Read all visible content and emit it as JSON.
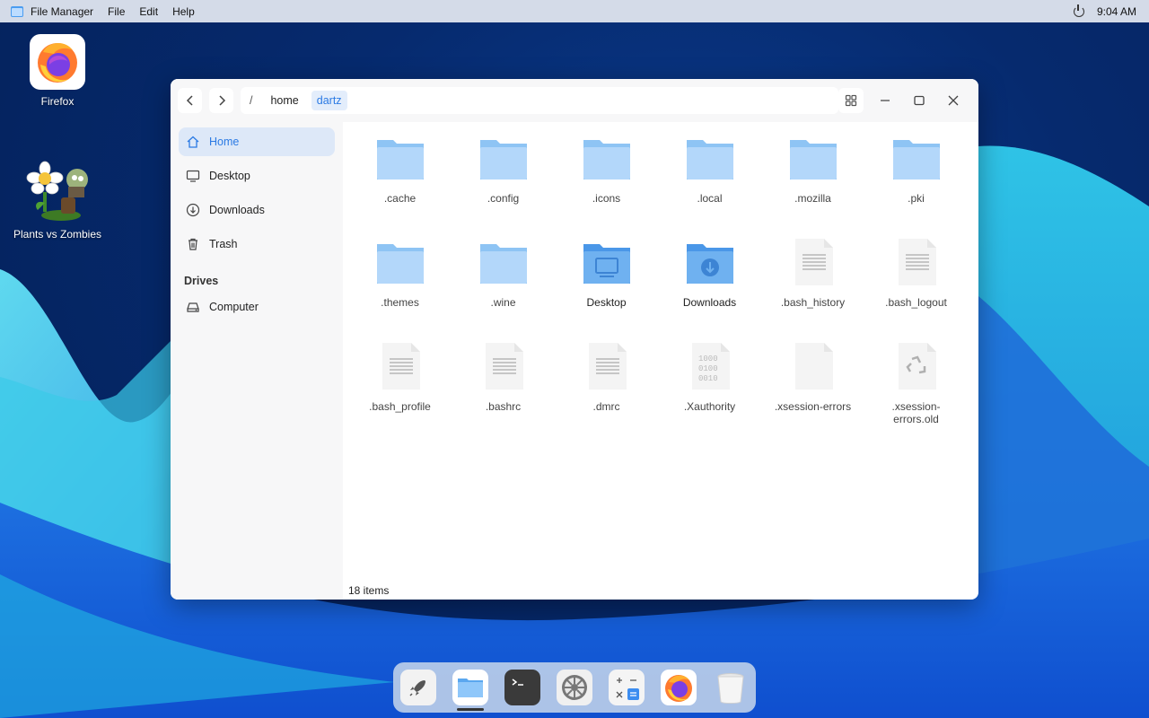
{
  "menubar": {
    "app_name": "File Manager",
    "menus": [
      "File",
      "Edit",
      "Help"
    ],
    "time": "9:04 AM",
    "icons": [
      "file-manager-icon",
      "power-icon"
    ]
  },
  "desktop": {
    "icons": [
      {
        "label": "Firefox",
        "icon": "firefox-icon"
      },
      {
        "label": "Plants vs Zombies",
        "icon": "plants-vs-zombies-icon"
      }
    ]
  },
  "window": {
    "breadcrumb": {
      "separator": "/",
      "parts": [
        "home",
        "dartz"
      ],
      "active": "dartz"
    },
    "sidebar": {
      "items": [
        {
          "label": "Home",
          "icon": "home-icon",
          "active": true
        },
        {
          "label": "Desktop",
          "icon": "desktop-icon"
        },
        {
          "label": "Downloads",
          "icon": "downloads-icon"
        },
        {
          "label": "Trash",
          "icon": "trash-icon"
        }
      ],
      "drives_heading": "Drives",
      "drives": [
        {
          "label": "Computer",
          "icon": "drive-icon"
        }
      ]
    },
    "files": [
      {
        "name": ".cache",
        "type": "folder"
      },
      {
        "name": ".config",
        "type": "folder"
      },
      {
        "name": ".icons",
        "type": "folder"
      },
      {
        "name": ".local",
        "type": "folder"
      },
      {
        "name": ".mozilla",
        "type": "folder"
      },
      {
        "name": ".pki",
        "type": "folder"
      },
      {
        "name": ".themes",
        "type": "folder"
      },
      {
        "name": ".wine",
        "type": "folder"
      },
      {
        "name": "Desktop",
        "type": "folder-desktop"
      },
      {
        "name": "Downloads",
        "type": "folder-downloads"
      },
      {
        "name": ".bash_history",
        "type": "text"
      },
      {
        "name": ".bash_logout",
        "type": "text"
      },
      {
        "name": ".bash_profile",
        "type": "text"
      },
      {
        "name": ".bashrc",
        "type": "text"
      },
      {
        "name": ".dmrc",
        "type": "text"
      },
      {
        "name": ".Xauthority",
        "type": "binary"
      },
      {
        "name": ".xsession-errors",
        "type": "blank"
      },
      {
        "name": ".xsession-errors.old",
        "type": "backup"
      }
    ],
    "status": "18 items"
  },
  "dock": {
    "items": [
      "launcher-icon",
      "file-manager-icon",
      "terminal-icon",
      "settings-icon",
      "calculator-icon",
      "firefox-icon",
      "trash-icon"
    ],
    "active": "file-manager-icon"
  },
  "colors": {
    "accent": "#2b7ae4",
    "folder": "#a9d2f8",
    "folder_user": "#6fb1f0",
    "menubar": "#d4dbe8"
  }
}
